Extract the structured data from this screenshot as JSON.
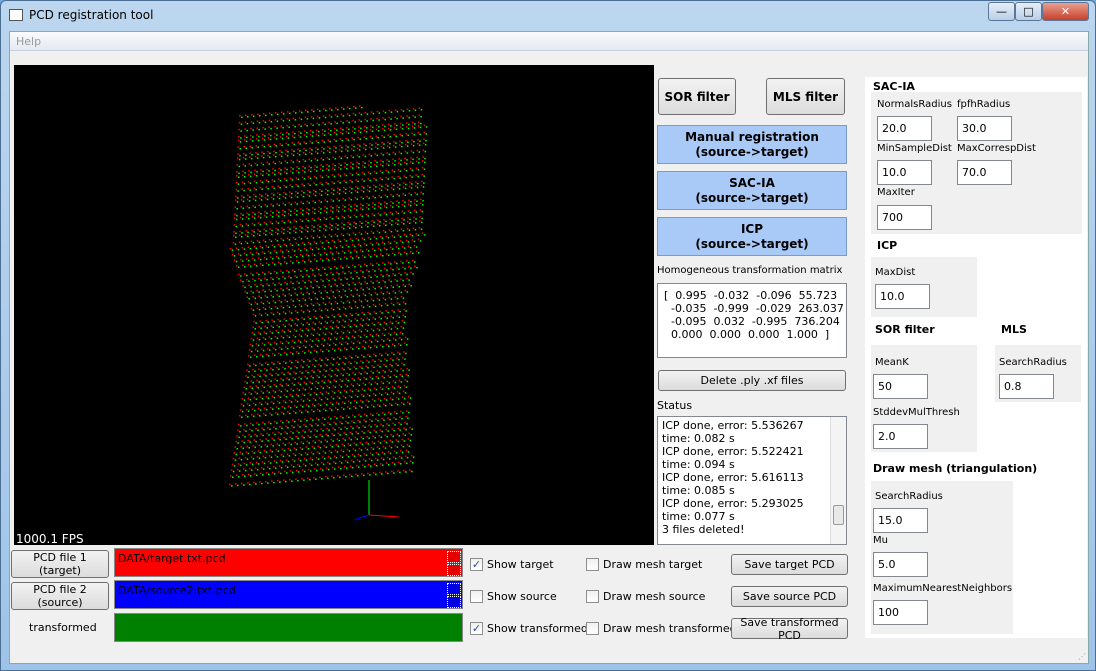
{
  "window": {
    "title": "PCD registration tool",
    "minimize": "—",
    "maximize": "□",
    "close": "✕"
  },
  "menu": {
    "items": [
      {
        "label": "Help"
      }
    ]
  },
  "viewer": {
    "fps": "1000.1 FPS",
    "target_color": "#ff0000",
    "source_color": "#0000ff",
    "transformed_color": "#00ff00"
  },
  "actions": {
    "sor_filter": "SOR filter",
    "mls_filter": "MLS filter",
    "manual_registration": "Manual registration\n(source->target)",
    "sac_ia": "SAC-IA\n(source->target)",
    "icp": "ICP\n(source->target)",
    "matrix_label": "Homogeneous transformation matrix",
    "matrix": "[  0.995  -0.032  -0.096  55.723\n  -0.035  -0.999  -0.029  263.037\n  -0.095  0.032  -0.995  736.204\n  0.000  0.000  0.000  1.000  ]",
    "delete_files": "Delete .ply .xf files",
    "status_label": "Status",
    "status_lines": [
      "ICP done, error: 5.536267",
      "time: 0.082 s",
      "ICP done, error: 5.522421",
      "time: 0.094 s",
      "ICP done, error: 5.616113",
      "time: 0.085 s",
      "ICP done, error: 5.293025",
      "time: 0.077 s",
      "3 files deleted!"
    ]
  },
  "files": {
    "target_button": "PCD file 1 (target)",
    "target_path": "DATA/target.txt.pcd",
    "target_color": "#ff0000",
    "source_button": "PCD file 2 (source)",
    "source_path": "DATA/source2.txt.pcd",
    "source_color": "#0000ff",
    "transformed_label": "transformed",
    "transformed_color": "#008000"
  },
  "display": {
    "show_target": {
      "label": "Show target",
      "checked": true
    },
    "show_source": {
      "label": "Show source",
      "checked": false
    },
    "show_transformed": {
      "label": "Show transformed",
      "checked": true
    },
    "mesh_target": {
      "label": "Draw mesh target",
      "checked": false
    },
    "mesh_source": {
      "label": "Draw mesh source",
      "checked": false
    },
    "mesh_transformed": {
      "label": "Draw mesh transformed",
      "checked": false
    },
    "save_target": "Save target PCD",
    "save_source": "Save source PCD",
    "save_transformed": "Save transformed PCD"
  },
  "params": {
    "sacia": {
      "title": "SAC-IA",
      "normals_radius_label": "NormalsRadius",
      "normals_radius": "20.0",
      "fpfh_radius_label": "fpfhRadius",
      "fpfh_radius": "30.0",
      "min_sample_dist_label": "MinSampleDist",
      "min_sample_dist": "10.0",
      "max_corresp_dist_label": "MaxCorrespDist",
      "max_corresp_dist": "70.0",
      "max_iter_label": "MaxIter",
      "max_iter": "700"
    },
    "icp": {
      "title": "ICP",
      "max_dist_label": "MaxDist",
      "max_dist": "10.0"
    },
    "sor": {
      "title": "SOR filter",
      "meank_label": "MeanK",
      "meank": "50",
      "stddev_label": "StddevMulThresh",
      "stddev": "2.0"
    },
    "mls": {
      "title": "MLS",
      "search_radius_label": "SearchRadius",
      "search_radius": "0.8"
    },
    "mesh": {
      "title": "Draw mesh (triangulation)",
      "search_radius_label": "SearchRadius",
      "search_radius": "15.0",
      "mu_label": "Mu",
      "mu": "5.0",
      "max_nn_label": "MaximumNearestNeighbors",
      "max_nn": "100"
    }
  }
}
